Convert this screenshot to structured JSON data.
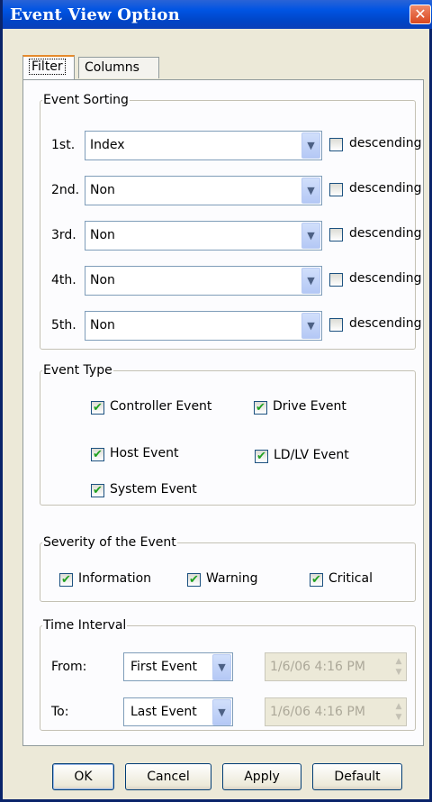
{
  "window": {
    "title": "Event View Option",
    "close_symbol": "✕"
  },
  "tabs": [
    {
      "label": "Filter",
      "active": true
    },
    {
      "label": "Columns",
      "active": false
    }
  ],
  "event_sorting": {
    "legend": "Event Sorting",
    "rows": [
      {
        "label": "1st.",
        "value": "Index",
        "checkbox_label": "descending",
        "checked": false
      },
      {
        "label": "2nd.",
        "value": "Non",
        "checkbox_label": "descending",
        "checked": false
      },
      {
        "label": "3rd.",
        "value": "Non",
        "checkbox_label": "descending",
        "checked": false
      },
      {
        "label": "4th.",
        "value": "Non",
        "checkbox_label": "descending",
        "checked": false
      },
      {
        "label": "5th.",
        "value": "Non",
        "checkbox_label": "descending",
        "checked": false
      }
    ]
  },
  "event_type": {
    "legend": "Event Type",
    "items": [
      {
        "label": "Controller Event",
        "checked": true
      },
      {
        "label": "Drive Event",
        "checked": true
      },
      {
        "label": "Host Event",
        "checked": true
      },
      {
        "label": "LD/LV Event",
        "checked": true
      },
      {
        "label": "System Event",
        "checked": true
      }
    ]
  },
  "severity": {
    "legend": "Severity of the Event",
    "items": [
      {
        "label": "Information",
        "checked": true
      },
      {
        "label": "Warning",
        "checked": true
      },
      {
        "label": "Critical",
        "checked": true
      }
    ]
  },
  "time_interval": {
    "legend": "Time Interval",
    "from": {
      "label": "From:",
      "value": "First Event",
      "datetime": "1/6/06 4:16 PM"
    },
    "to": {
      "label": "To:",
      "value": "Last Event",
      "datetime": "1/6/06 4:16 PM"
    }
  },
  "buttons": {
    "ok": "OK",
    "cancel": "Cancel",
    "apply": "Apply",
    "default": "Default"
  },
  "symbols": {
    "check": "✔",
    "dropdown": "▼",
    "spin_up": "▲",
    "spin_down": "▼"
  },
  "colors": {
    "title_bar": "#0054e3",
    "close_button": "#d9471f",
    "check": "#21a121"
  }
}
